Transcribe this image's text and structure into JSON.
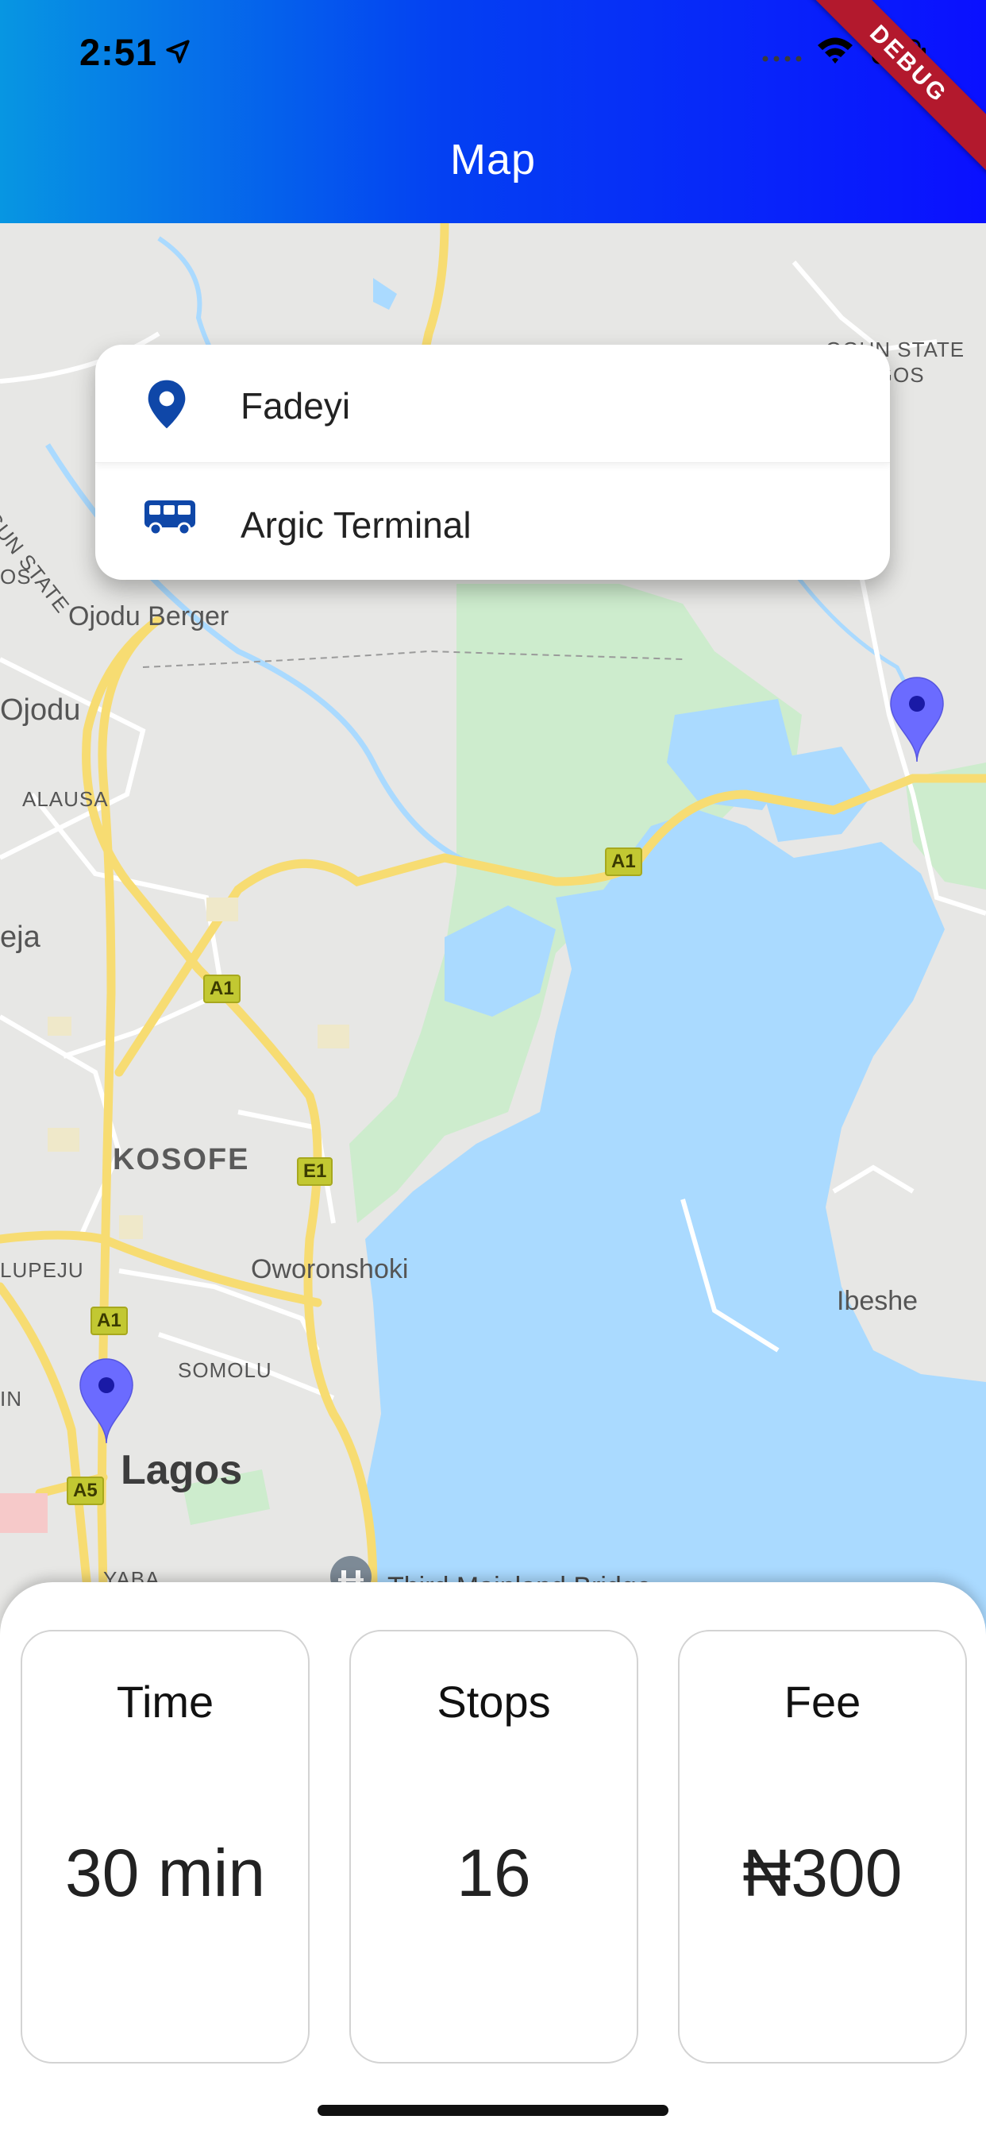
{
  "status_bar": {
    "time": "2:51"
  },
  "app_bar": {
    "title": "Map",
    "debug_banner": "DEBUG"
  },
  "route": {
    "origin": {
      "icon": "location-pin-icon",
      "label": "Fadeyi"
    },
    "destination": {
      "icon": "bus-icon",
      "label": "Argic Terminal"
    }
  },
  "map": {
    "labels": {
      "ogun_lagos_right_1": "OGUN STATE",
      "ogun_lagos_right_2": "LAGOS",
      "ogun_state_left": "OGUN STATE",
      "lagos_left": "OS",
      "ojodu_berger": "Ojodu Berger",
      "ojodu": "Ojodu",
      "alausa": "ALAUSA",
      "ikeja": "eja",
      "kosofe": "KOSOFE",
      "oworonshoki": "Oworonshoki",
      "ilupeju": "LUPEJU",
      "somolu": "SOMOLU",
      "in": "IN",
      "lagos": "Lagos",
      "yaba": "YABA",
      "ibeshe": "Ibeshe",
      "third_mainland": "Third Mainland Bridge"
    },
    "shields": {
      "a1_top": "A1",
      "a1_mid": "A1",
      "e1": "E1",
      "a1_low": "A1",
      "a5": "A5"
    },
    "colors": {
      "land": "#e7e7e5",
      "water": "#aadaff",
      "park": "#cdeccd",
      "road": "#f7dc72",
      "pin": "#6b6bff"
    }
  },
  "stats": [
    {
      "title": "Time",
      "value": "30 min"
    },
    {
      "title": "Stops",
      "value": "16"
    },
    {
      "title": "Fee",
      "value": "₦300"
    }
  ]
}
